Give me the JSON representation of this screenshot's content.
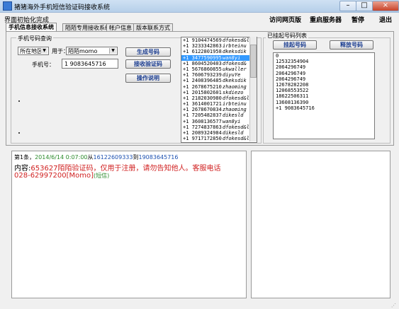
{
  "window": {
    "title": "猪猪海外手机短信验证码接收系统",
    "minimize": "–",
    "maximize": "□",
    "close": "×"
  },
  "menu": {
    "status": "界面初始化完成",
    "items": [
      "访问网页版",
      "重启服务器",
      "暂停",
      "退出"
    ]
  },
  "tabs": [
    "手机信息接收系统",
    "陌陌专用接收系统",
    "帐户信息",
    "版本联系方式"
  ],
  "query": {
    "group_title": "手机号码查询",
    "region_select": "所在地区",
    "purpose_label": "用于：",
    "purpose_select": "陌陌momo",
    "phone_label": "手机号：",
    "phone_value": "1 9083645716",
    "buttons": [
      "生成号码",
      "接收验证码",
      "操作说明"
    ],
    "numbers": [
      {
        "num": "+1 9104474569",
        "acc": "dfokesd&l"
      },
      {
        "num": "+1 3233342863",
        "acc": "irbteinu"
      },
      {
        "num": "+1 6122801958",
        "acc": "dkeksdik"
      },
      {
        "num": "+1 3477590995",
        "acc": "wan8yi"
      },
      {
        "num": "+1 8604520403",
        "acc": "dfokesd&"
      },
      {
        "num": "+1 5676860855",
        "acc": "ukwaller"
      },
      {
        "num": "+1 7606793239",
        "acc": "diyuYe"
      },
      {
        "num": "+1 2408396485",
        "acc": "dkeksdik"
      },
      {
        "num": "+1 2678675210",
        "acc": "zhaoming"
      },
      {
        "num": "+1 2015802601",
        "acc": "skdiezo"
      },
      {
        "num": "+1 2182030980",
        "acc": "dfokesd&l"
      },
      {
        "num": "+1 3614001721",
        "acc": "irbteinu"
      },
      {
        "num": "+1 2678670834",
        "acc": "zhaoming"
      },
      {
        "num": "+1 7205482837",
        "acc": "dikesld"
      },
      {
        "num": "+1 3608136577",
        "acc": "wan8yi"
      },
      {
        "num": "+1 7274837863",
        "acc": "dfokesd&l"
      },
      {
        "num": "+1 2089324984",
        "acc": "dikesld"
      },
      {
        "num": "+1 9717172850",
        "acc": "dfokesd&l"
      }
    ],
    "selected_index": 3
  },
  "hang": {
    "group_title": "已挂起号码列表",
    "buttons": [
      "挂起号码",
      "释放号码"
    ],
    "numbers": [
      "0",
      "12532354904",
      "2064296749",
      "2064296749",
      "2064296749",
      "12678282208",
      "12068553522",
      "18622506311",
      "13608136390",
      "+1 9083645716"
    ]
  },
  "log": {
    "line1_prefix": "第1条，",
    "line1_date": "2014/6/14 0:07:00",
    "line1_from_label": "从",
    "line1_from": "16122609333",
    "line1_to_label": "到",
    "line1_to": "19083645716",
    "content_label": "内容:",
    "content_line1": "653627陌陌验证码，仅用于注册，请勿告知他人。客服电话",
    "content_line2": "028-62997200[Momo]",
    "content_tag": "(短信)"
  },
  "colors": {
    "date": "#2a8a2a",
    "number": "#1a4fb0",
    "content": "#d02020",
    "tag": "#2a8a2a"
  }
}
